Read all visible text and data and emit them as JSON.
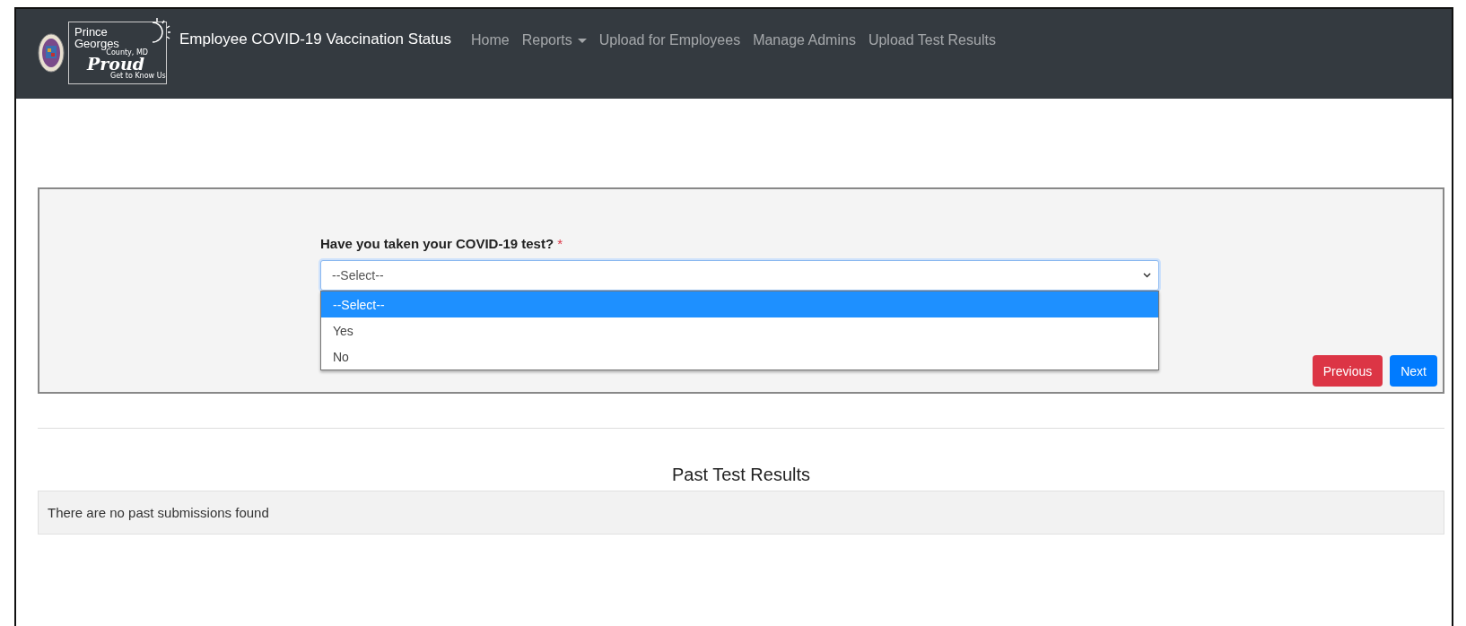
{
  "navbar": {
    "logo": {
      "lines": [
        "Prince",
        "Georges",
        "County, MD",
        "Proud",
        "Get to Know Us"
      ]
    },
    "title": "Employee COVID-19 Vaccination Status",
    "links": [
      {
        "label": "Home",
        "kind": "link"
      },
      {
        "label": "Reports",
        "kind": "dropdown"
      },
      {
        "label": "Upload for Employees",
        "kind": "link"
      },
      {
        "label": "Manage Admins",
        "kind": "link"
      },
      {
        "label": "Upload Test Results",
        "kind": "link"
      }
    ]
  },
  "form": {
    "question": "Have you taken your COVID-19 test?",
    "required_mark": "*",
    "select": {
      "value": "--Select--",
      "expanded": true,
      "options": [
        {
          "label": "--Select--",
          "selected": true
        },
        {
          "label": "Yes",
          "selected": false
        },
        {
          "label": "No",
          "selected": false
        }
      ]
    },
    "buttons": [
      {
        "label": "Previous",
        "kind": "danger"
      },
      {
        "label": "Next",
        "kind": "primary"
      }
    ]
  },
  "past_results": {
    "title": "Past Test Results",
    "message": "There are no past submissions found"
  }
}
